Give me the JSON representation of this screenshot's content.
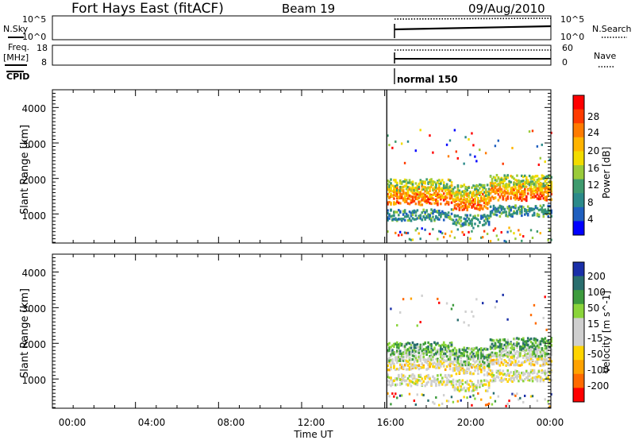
{
  "header": {
    "station": "Fort Hays East (fitACF)",
    "beam": "Beam 19",
    "date": "09/Aug/2010"
  },
  "top_panels": {
    "nsky": {
      "label": "N.Sky",
      "ticks": [
        "10^5",
        "10^0"
      ]
    },
    "nsearch": {
      "label": "N.Search",
      "ticks": [
        "10^5",
        "10^0"
      ]
    },
    "freq": {
      "label": "Freq.",
      "unit": "[MHz]",
      "ticks": [
        "18",
        "8"
      ]
    },
    "nave": {
      "label": "Nave",
      "ticks": [
        "60",
        "0"
      ]
    },
    "cpid": {
      "label": "CPID",
      "value": "normal 150"
    }
  },
  "power_panel": {
    "ylabel": "Slant Range [km]",
    "yticks": [
      "4000",
      "3000",
      "2000",
      "1000"
    ],
    "colorbar_label": "Power [dB]",
    "colorbar_ticks": [
      "28",
      "24",
      "20",
      "16",
      "12",
      "8",
      "4"
    ],
    "colors": [
      "#ff0000",
      "#ff3b00",
      "#ff7b00",
      "#ffb400",
      "#f2dc00",
      "#9acb3a",
      "#3f9b6e",
      "#2b8a8a",
      "#1f5fbf",
      "#0000ff"
    ]
  },
  "velocity_panel": {
    "ylabel": "Slant Range [km]",
    "yticks": [
      "4000",
      "3000",
      "2000",
      "1000"
    ],
    "colorbar_label": "Velocity [m s^-1]",
    "colorbar_ticks": [
      "200",
      "100",
      "50",
      "15",
      "-15",
      "-50",
      "-100",
      "-200"
    ],
    "colors": [
      "#1a2fa8",
      "#2a6e6e",
      "#3d9b3d",
      "#8ad43a",
      "#cfcfcf",
      "#cfcfcf",
      "#ffd400",
      "#ffa200",
      "#ff6a00",
      "#ff0000"
    ]
  },
  "xaxis": {
    "ticks": [
      "00:00",
      "04:00",
      "08:00",
      "12:00",
      "16:00",
      "20:00",
      "00:00"
    ],
    "label": "Time UT"
  },
  "chart_data": [
    {
      "type": "heatmap",
      "title": "Power",
      "xlabel": "Time UT",
      "ylabel": "Slant Range [km]",
      "xlim": [
        0,
        24
      ],
      "ylim": [
        180,
        4500
      ],
      "zlim": [
        0,
        30
      ],
      "data_start_hour": 16.1,
      "bands": [
        {
          "range_km": 1000,
          "value": 8
        },
        {
          "range_km": 1450,
          "value": 24
        },
        {
          "range_km": 1650,
          "value": 20
        },
        {
          "range_km": 1850,
          "value": 14
        }
      ]
    },
    {
      "type": "heatmap",
      "title": "Velocity",
      "xlabel": "Time UT",
      "ylabel": "Slant Range [km]",
      "xlim": [
        0,
        24
      ],
      "ylim": [
        180,
        4500
      ],
      "zlim": [
        -200,
        200
      ],
      "data_start_hour": 16.1,
      "bands": [
        {
          "range_km": 1000,
          "value": 0
        },
        {
          "range_km": 1450,
          "value": -30
        },
        {
          "range_km": 1700,
          "value": 40
        },
        {
          "range_km": 1900,
          "value": 100
        }
      ]
    }
  ]
}
